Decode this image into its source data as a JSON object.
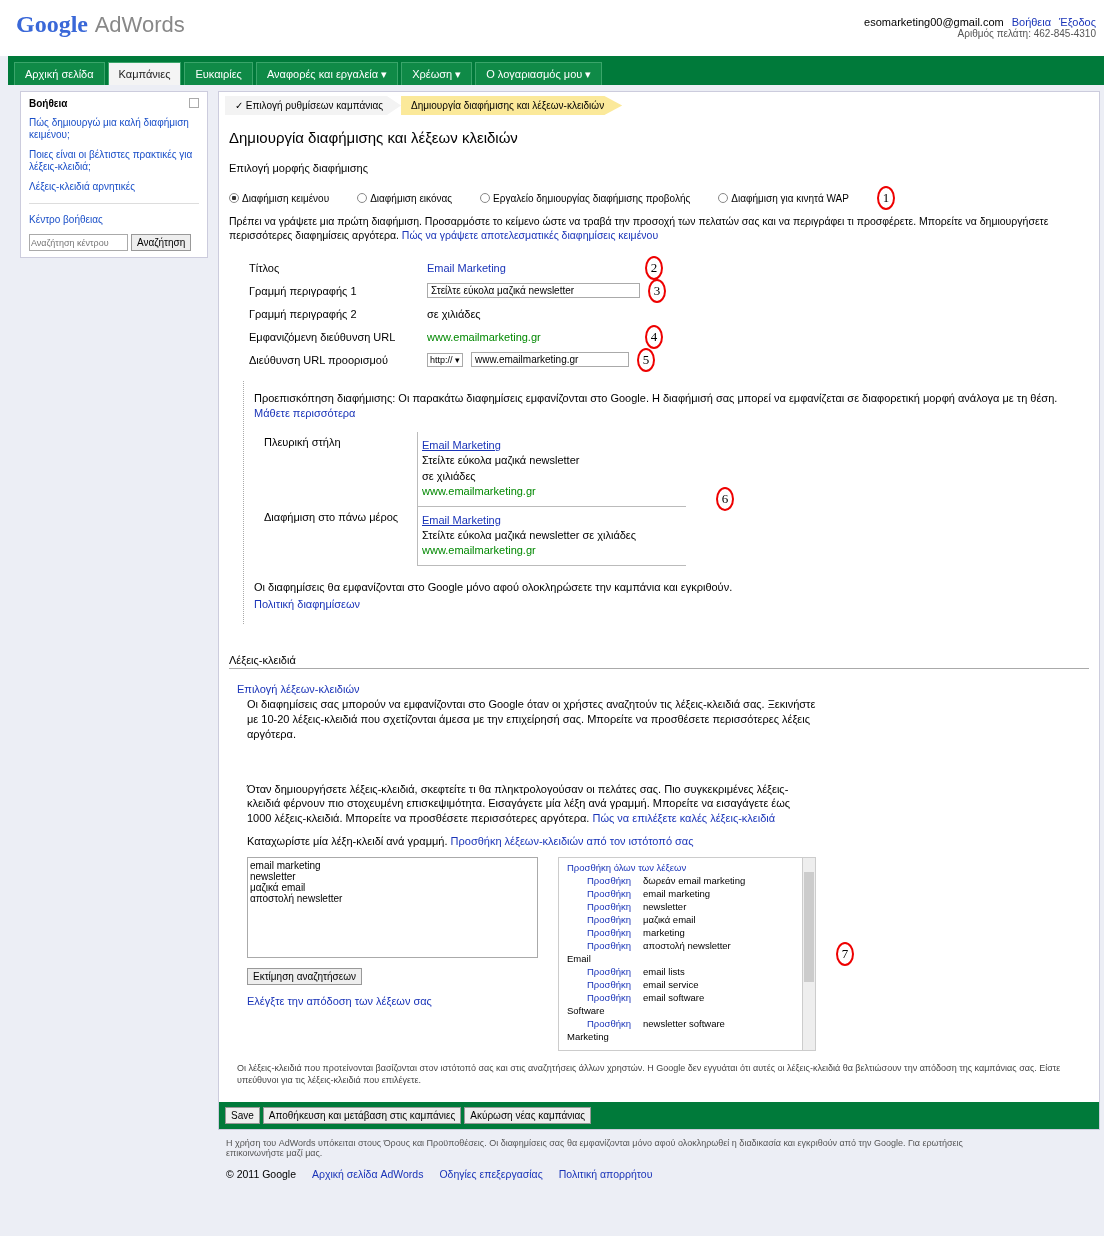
{
  "header": {
    "logo": "Google",
    "product": "AdWords",
    "email": "esomarketing00@gmail.com",
    "links": [
      "Βοήθεια",
      "Έξοδος"
    ],
    "customer": "Αριθμός πελάτη: 462-845-4310"
  },
  "nav": [
    {
      "label": "Αρχική σελίδα",
      "selected": false
    },
    {
      "label": "Καμπάνιες",
      "selected": true
    },
    {
      "label": "Ευκαιρίες",
      "selected": false
    },
    {
      "label": "Αναφορές και εργαλεία ▾",
      "selected": false
    },
    {
      "label": "Χρέωση ▾",
      "selected": false
    },
    {
      "label": "Ο λογαριασμός μου ▾",
      "selected": false
    }
  ],
  "sidebar": {
    "title": "Βοήθεια",
    "links": [
      "Πώς δημιουργώ μια καλή διαφήμιση κειμένου;",
      "Ποιες είναι οι βέλτιστες πρακτικές για λέξεις-κλειδιά;",
      "Λέξεις-κλειδιά αρνητικές"
    ],
    "help_center": "Κέντρο βοήθειας",
    "search": {
      "placeholder": "Αναζήτηση κέντρου"
    },
    "search_button": "Αναζήτηση"
  },
  "steps": [
    {
      "label": "✓ Επιλογή ρυθμίσεων καμπάνιας",
      "selected": false
    },
    {
      "label": "Δημιουργία διαφήμισης και λέξεων-κλειδιών",
      "selected": true
    }
  ],
  "title": "Δημιουργία διαφήμισης και λέξεων κλειδιών",
  "ad_format_label": "Επιλογή μορφής διαφήμισης",
  "ad_formats": [
    {
      "label": "Διαφήμιση κειμένου",
      "selected": true
    },
    {
      "label": "Διαφήμιση εικόνας",
      "selected": false
    },
    {
      "label": "Εργαλείο δημιουργίας διαφήμισης προβολής",
      "selected": false
    },
    {
      "label": "Διαφήμιση για κινητά WAP",
      "selected": false
    }
  ],
  "format_marker": "1",
  "intro": "Πρέπει να γράψετε μια πρώτη διαφήμιση. Προσαρμόστε το κείμενο ώστε να τραβά την προσοχή των πελατών σας και να περιγράφει τι προσφέρετε. Μπορείτε να δημιουργήσετε περισσότερες διαφημίσεις αργότερα.",
  "intro_link": "Πώς να γράψετε αποτελεσματικές διαφημίσεις κειμένου",
  "fields": [
    {
      "label": "Τίτλος",
      "value": "Email Marketing",
      "kind": "link",
      "marker": "2"
    },
    {
      "label": "Γραμμή περιγραφής 1",
      "value": "Στείλτε εύκολα μαζικά newsletter",
      "kind": "input",
      "marker": "3"
    },
    {
      "label": "Γραμμή περιγραφής 2",
      "value": "σε χιλιάδες",
      "kind": "text"
    },
    {
      "label": "Εμφανιζόμενη διεύθυνση URL",
      "value": "www.emailmarketing.gr",
      "kind": "url",
      "marker": "4"
    },
    {
      "label": "Διεύθυνση URL προορισμού",
      "prefix": "http://",
      "select_arrow": "▾",
      "value": "www.emailmarketing.gr",
      "kind": "select",
      "marker": "5"
    }
  ],
  "preview": {
    "note": "Προεπισκόπηση διαφήμισης: Οι παρακάτω διαφημίσεις εμφανίζονται στο Google. Η διαφήμισή σας μπορεί να εμφανίζεται σε διαφορετική μορφή ανάλογα με τη θέση.",
    "note_link": "Μάθετε περισσότερα",
    "marker": "6",
    "ads": [
      {
        "placement": "Πλευρική στήλη",
        "title": "Email Marketing",
        "lines": [
          "Στείλτε εύκολα μαζικά newsletter",
          "σε χιλιάδες"
        ],
        "url": "www.emailmarketing.gr"
      },
      {
        "placement": "Διαφήμιση στο πάνω μέρος",
        "title": "Email Marketing",
        "lines": [
          "Στείλτε εύκολα μαζικά newsletter σε χιλιάδες"
        ],
        "url": "www.emailmarketing.gr"
      }
    ],
    "footnote": "Οι διαφημίσεις θα εμφανίζονται στο Google μόνο αφού ολοκληρώσετε την καμπάνια και εγκριθούν.",
    "footnote_link": "Πολιτική διαφημίσεων"
  },
  "keywords": {
    "heading": "Λέξεις-κλειδιά",
    "tip_link": "Επιλογή λέξεων-κλειδιών",
    "tip": "Οι διαφημίσεις σας μπορούν να εμφανίζονται στο Google όταν οι χρήστες αναζητούν τις λέξεις-κλειδιά σας. Ξεκινήστε με 10-20 λέξεις-κλειδιά που σχετίζονται άμεσα με την επιχείρησή σας. Μπορείτε να προσθέσετε περισσότερες λέξεις αργότερα.",
    "body": "Όταν δημιουργήσετε λέξεις-κλειδιά, σκεφτείτε τι θα πληκτρολογούσαν οι πελάτες σας. Πιο συγκεκριμένες λέξεις-κλειδιά φέρνουν πιο στοχευμένη επισκεψιμότητα. Εισαγάγετε μία λέξη ανά γραμμή. Μπορείτε να εισαγάγετε έως 1000 λέξεις-κλειδιά. Μπορείτε να προσθέσετε περισσότερες αργότερα.",
    "body_link": "Πώς να επιλέξετε καλές λέξεις-κλειδιά",
    "prompt": "Καταχωρίστε μία λέξη-κλειδί ανά γραμμή.",
    "prompt_link": "Προσθήκη λέξεων-κλειδιών από τον ιστότοπό σας",
    "entered": [
      "email marketing",
      "newsletter",
      "μαζικά email",
      "αποστολή newsletter"
    ],
    "estimate_button": "Εκτίμηση αναζητήσεων",
    "more_link": "Ελέγξτε την απόδοση των λέξεων σας",
    "marker": "7",
    "suggestions": [
      {
        "kind": "heading",
        "text": "Προσθήκη όλων των λέξεων"
      },
      {
        "kind": "item",
        "action": "Προσθήκη",
        "text": "δωρεάν email marketing"
      },
      {
        "kind": "item",
        "action": "Προσθήκη",
        "text": "email marketing"
      },
      {
        "kind": "item",
        "action": "Προσθήκη",
        "text": "newsletter"
      },
      {
        "kind": "item",
        "action": "Προσθήκη",
        "text": "μαζικά email"
      },
      {
        "kind": "item",
        "action": "Προσθήκη",
        "text": "marketing"
      },
      {
        "kind": "item",
        "action": "Προσθήκη",
        "text": "αποστολή newsletter"
      },
      {
        "kind": "category",
        "text": "Email"
      },
      {
        "kind": "item",
        "action": "Προσθήκη",
        "text": "email lists"
      },
      {
        "kind": "item",
        "action": "Προσθήκη",
        "text": "email service"
      },
      {
        "kind": "item",
        "action": "Προσθήκη",
        "text": "email software"
      },
      {
        "kind": "category",
        "text": "Software"
      },
      {
        "kind": "item",
        "action": "Προσθήκη",
        "text": "newsletter software"
      },
      {
        "kind": "category",
        "text": "Marketing"
      }
    ],
    "disclaimer": "Οι λέξεις-κλειδιά που προτείνονται βασίζονται στον ιστότοπό σας και στις αναζητήσεις άλλων χρηστών. Η Google δεν εγγυάται ότι αυτές οι λέξεις-κλειδιά θα βελτιώσουν την απόδοση της καμπάνιας σας. Είστε υπεύθυνοι για τις λέξεις-κλειδιά που επιλέγετε."
  },
  "actions": [
    "Save",
    "Αποθήκευση και μετάβαση στις καμπάνιες",
    "Ακύρωση νέας καμπάνιας"
  ],
  "footer": {
    "text": "Η χρήση του AdWords υπόκειται στους Όρους και Προϋποθέσεις. Οι διαφημίσεις σας θα εμφανίζονται μόνο αφού ολοκληρωθεί η διαδικασία και εγκριθούν από την Google. Για ερωτήσεις επικοινωνήστε μαζί μας.",
    "copyright": "© 2011 Google",
    "links": [
      "Αρχική σελίδα AdWords",
      "Οδηγίες επεξεργασίας",
      "Πολιτική απορρήτου"
    ]
  }
}
